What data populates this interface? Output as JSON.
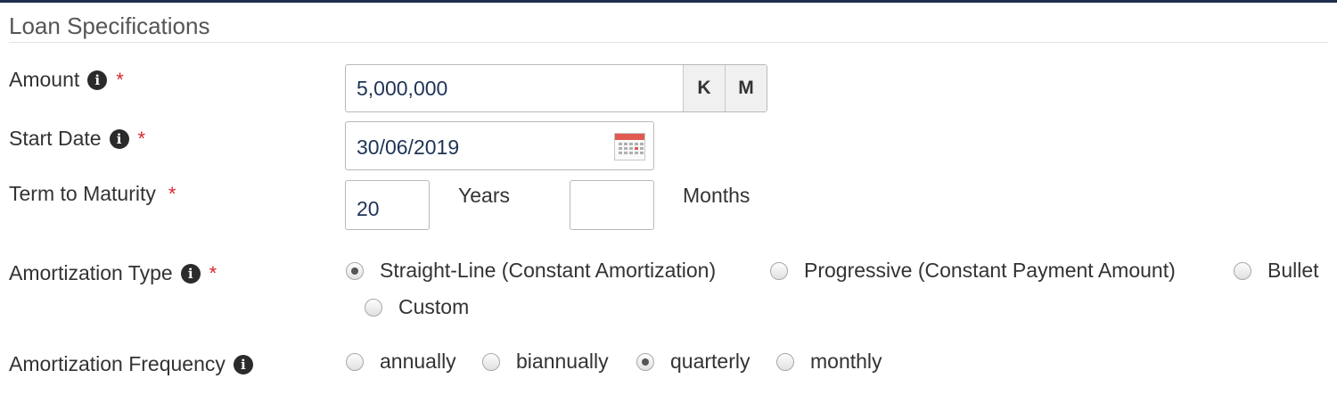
{
  "section": {
    "title": "Loan Specifications"
  },
  "amount": {
    "label": "Amount",
    "required_mark": "*",
    "value": "5,000,000",
    "unit_k": "K",
    "unit_m": "M"
  },
  "start_date": {
    "label": "Start Date",
    "required_mark": "*",
    "value": "30/06/2019"
  },
  "term": {
    "label": "Term to Maturity",
    "required_mark": "*",
    "years_value": "20",
    "years_label": "Years",
    "months_value": "",
    "months_label": "Months"
  },
  "amortization_type": {
    "label": "Amortization Type",
    "required_mark": "*",
    "options": [
      {
        "label": "Straight-Line (Constant Amortization)",
        "checked": true
      },
      {
        "label": "Progressive (Constant Payment Amount)",
        "checked": false
      },
      {
        "label": "Bullet",
        "checked": false
      },
      {
        "label": "Custom",
        "checked": false
      }
    ]
  },
  "amortization_frequency": {
    "label": "Amortization Frequency",
    "options": [
      {
        "label": "annually",
        "checked": false
      },
      {
        "label": "biannually",
        "checked": false
      },
      {
        "label": "quarterly",
        "checked": true
      },
      {
        "label": "monthly",
        "checked": false
      }
    ]
  },
  "icons": {
    "info": "info-icon",
    "calendar": "calendar-icon",
    "info_glyph": "i"
  },
  "colors": {
    "required": "#d9262f",
    "value_text": "#1f3456",
    "top_rule": "#1f2d4d"
  }
}
